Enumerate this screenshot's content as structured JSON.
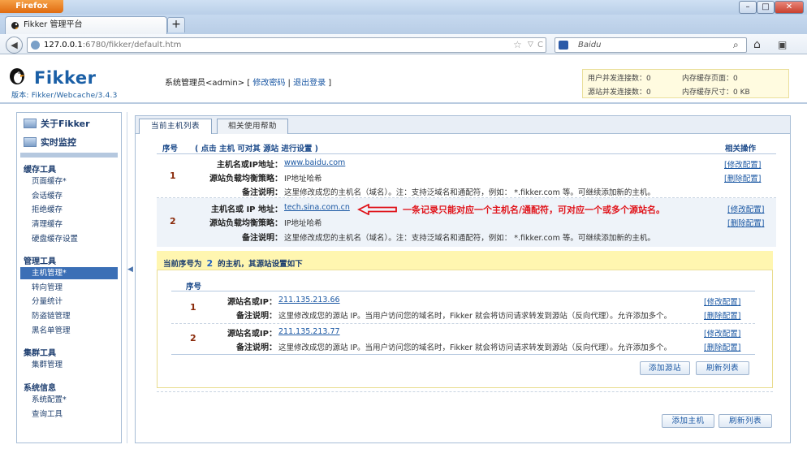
{
  "browser": {
    "app_button": "Firefox",
    "tab_title": "Fikker 管理平台",
    "new_tab": "+",
    "url_host": "127.0.0.1",
    "url_path": ":6780/fikker/default.htm",
    "search_placeholder": "Baidu",
    "win_min": "–",
    "win_max": "□",
    "win_close": "✕"
  },
  "header": {
    "logo": "Fikker",
    "version": "版本: Fikker/Webcache/3.4.3",
    "user_prefix": "系统管理员<admin> [",
    "change_password": "修改密码",
    "sep": "|",
    "logout": "退出登录",
    "user_suffix": "]"
  },
  "stats": {
    "user_conn": "用户并发连接数：0",
    "mem_pages": "内存缓存页面：0",
    "origin_conn": "源站并发连接数：0",
    "mem_size": "内存缓存尺寸：0 KB"
  },
  "sidebar": {
    "about": "关于Fikker",
    "monitor": "实时监控",
    "groups": [
      {
        "title": "缓存工具",
        "items": [
          "页面缓存*",
          "会话缓存",
          "拒绝缓存",
          "清理缓存",
          "硬盘缓存设置"
        ]
      },
      {
        "title": "管理工具",
        "items": [
          "主机管理*",
          "转向管理",
          "分量统计",
          "防盗链管理",
          "黑名单管理"
        ]
      },
      {
        "title": "集群工具",
        "items": [
          "集群管理"
        ]
      },
      {
        "title": "系统信息",
        "items": [
          "系统配置*",
          "查询工具"
        ]
      }
    ],
    "collapse": "◀"
  },
  "tabs": {
    "list": "当前主机列表",
    "help": "相关使用帮助"
  },
  "host_table": {
    "col_num": "序号",
    "col_hint": "( 点击 主机 可对其 源站 进行设置 )",
    "col_ops": "相关操作",
    "label_host1": "主机名或IP地址：",
    "label_host2": "主机名或 IP 地址：",
    "label_lb": "源站负载均衡策略：",
    "label_note": "备注说明：",
    "op_edit": "[修改配置]",
    "op_delete": "[删除配置]",
    "rows": [
      {
        "num": "1",
        "host": "www.baidu.com",
        "lb": "IP地址哈希",
        "note": "这里修改成您的主机名（域名）。注：支持泛域名和通配符，例如： *.fikker.com 等。可继续添加新的主机。"
      },
      {
        "num": "2",
        "host": "tech.sina.com.cn",
        "lb": "IP地址哈希",
        "note": "这里修改成您的主机名（域名）。注：支持泛域名和通配符，例如： *.fikker.com 等。可继续添加新的主机。"
      }
    ],
    "annotation": "一条记录只能对应一个主机名/通配符，可对应一个或多个源站名。"
  },
  "origin_panel": {
    "title_prefix": "当前序号为",
    "title_num": "2",
    "title_suffix": "的主机，其源站设置如下",
    "col_num": "序号",
    "label_ip": "源站名或IP：",
    "label_note": "备注说明：",
    "op_edit": "[修改配置]",
    "op_delete": "[删除配置]",
    "rows": [
      {
        "num": "1",
        "ip": "211.135.213.66",
        "note": "这里修改成您的源站 IP。当用户访问您的域名时，Fikker 就会将访问请求转发到源站（反向代理）。允许添加多个。"
      },
      {
        "num": "2",
        "ip": "211.135.213.77",
        "note": "这里修改成您的源站 IP。当用户访问您的域名时，Fikker 就会将访问请求转发到源站（反向代理）。允许添加多个。"
      }
    ],
    "add_origin": "添加源站",
    "refresh": "刷新列表"
  },
  "bottom": {
    "add_host": "添加主机",
    "refresh": "刷新列表"
  }
}
